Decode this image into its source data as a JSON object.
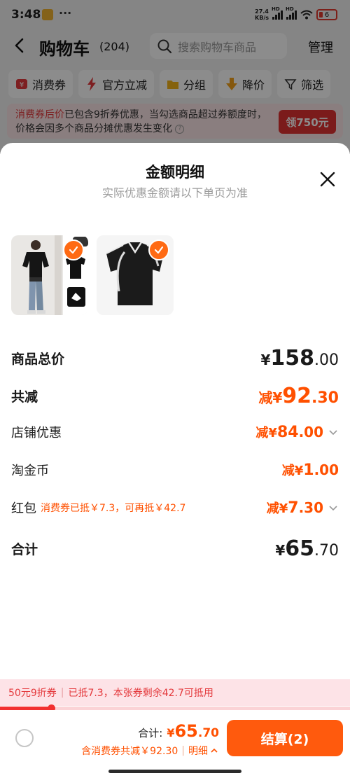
{
  "status_bar": {
    "time": "3:48",
    "dots": "···",
    "speed_value": "27.4",
    "speed_unit": "KB/s",
    "battery": "6"
  },
  "header": {
    "title": "购物车",
    "count": "(204)",
    "search_placeholder": "搜索购物车商品",
    "manage": "管理"
  },
  "chips": [
    {
      "label": "消费券",
      "icon": "coupon-icon"
    },
    {
      "label": "官方立减",
      "icon": "lightning-icon"
    },
    {
      "label": "分组",
      "icon": "folder-icon"
    },
    {
      "label": "降价",
      "icon": "price-drop-icon"
    },
    {
      "label": "筛选",
      "icon": "filter-icon"
    }
  ],
  "notice": {
    "highlight": "消费券后价",
    "text": "已包含9折券优惠，当勾选商品超过券额度时，价格会因多个商品分摊优惠发生变化",
    "button": "领750元"
  },
  "sheet": {
    "title": "金额明细",
    "subtitle": "实际优惠金额请以下单页为准",
    "rows": {
      "total_price": {
        "label": "商品总价",
        "prefix": "¥",
        "int": "158",
        "dec": ".00"
      },
      "total_reduce": {
        "label": "共减",
        "prefix": "减¥",
        "int": "92",
        "dec": ".30"
      },
      "store_discount": {
        "label": "店铺优惠",
        "prefix": "减¥",
        "int": "84",
        "dec": ".00"
      },
      "coins": {
        "label": "淘金币",
        "prefix": "减¥",
        "int": "1",
        "dec": ".00"
      },
      "red_packet": {
        "label": "红包",
        "note": "消费券已抵￥7.3，可再抵￥42.7",
        "prefix": "减¥",
        "int": "7",
        "dec": ".30"
      },
      "sum": {
        "label": "合计",
        "prefix": "¥",
        "int": "65",
        "dec": ".70"
      }
    }
  },
  "coupon_strip": {
    "name": "50元9折券",
    "used": "已抵7.3，本张券剩余42.7可抵用",
    "progress_fraction": 0.146
  },
  "bottom_bar": {
    "total_label": "合计:",
    "total_prefix": "¥",
    "total_int": "65",
    "total_dec": ".70",
    "discount_text": "含消费券共减￥92.30",
    "detail_link": "明细",
    "checkout": "结算(2)"
  },
  "colors": {
    "accent": "#ff5000",
    "button": "#ff5a0d",
    "red": "#e4393c"
  }
}
